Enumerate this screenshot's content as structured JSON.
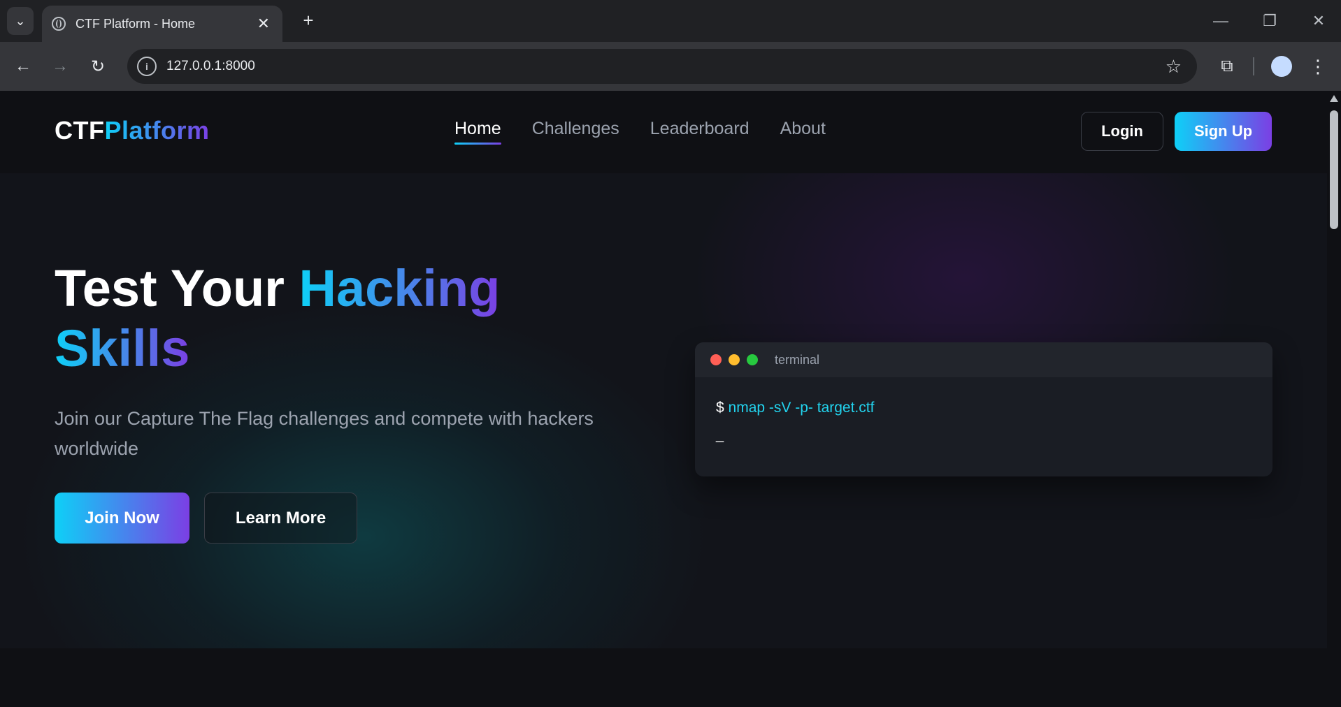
{
  "browser": {
    "tab_title": "CTF Platform - Home",
    "tab_close": "✕",
    "new_tab": "+",
    "url": "127.0.0.1:8000",
    "window_controls": {
      "minimize": "—",
      "restore": "❐",
      "close": "✕"
    },
    "icons": {
      "tab_search": "chevron-down-icon",
      "back": "back-arrow-icon",
      "forward": "forward-arrow-icon",
      "reload": "reload-icon",
      "site_info": "info-icon",
      "bookmark": "star-icon",
      "extensions": "puzzle-icon",
      "menu": "kebab-menu-icon"
    }
  },
  "site": {
    "logo_main": "CTF",
    "logo_accent": "Platform",
    "nav": [
      {
        "label": "Home",
        "active": true
      },
      {
        "label": "Challenges",
        "active": false
      },
      {
        "label": "Leaderboard",
        "active": false
      },
      {
        "label": "About",
        "active": false
      }
    ],
    "login_label": "Login",
    "signup_label": "Sign Up"
  },
  "hero": {
    "title_plain": "Test Your ",
    "title_gradient_1": "Hacking",
    "title_gradient_2": "Skills",
    "subtitle": "Join our Capture The Flag challenges and compete with hackers worldwide",
    "join_label": "Join Now",
    "learn_label": "Learn More"
  },
  "terminal": {
    "title": "terminal",
    "prompt": "$",
    "command": "nmap -sV -p- target.ctf",
    "cursor": "_",
    "dot_colors": [
      "#ff5f56",
      "#ffbd2e",
      "#27c93f"
    ]
  },
  "colors": {
    "accent_start": "#0ed0f7",
    "accent_end": "#7b3fe4",
    "terminal_command": "#22d3ee"
  }
}
